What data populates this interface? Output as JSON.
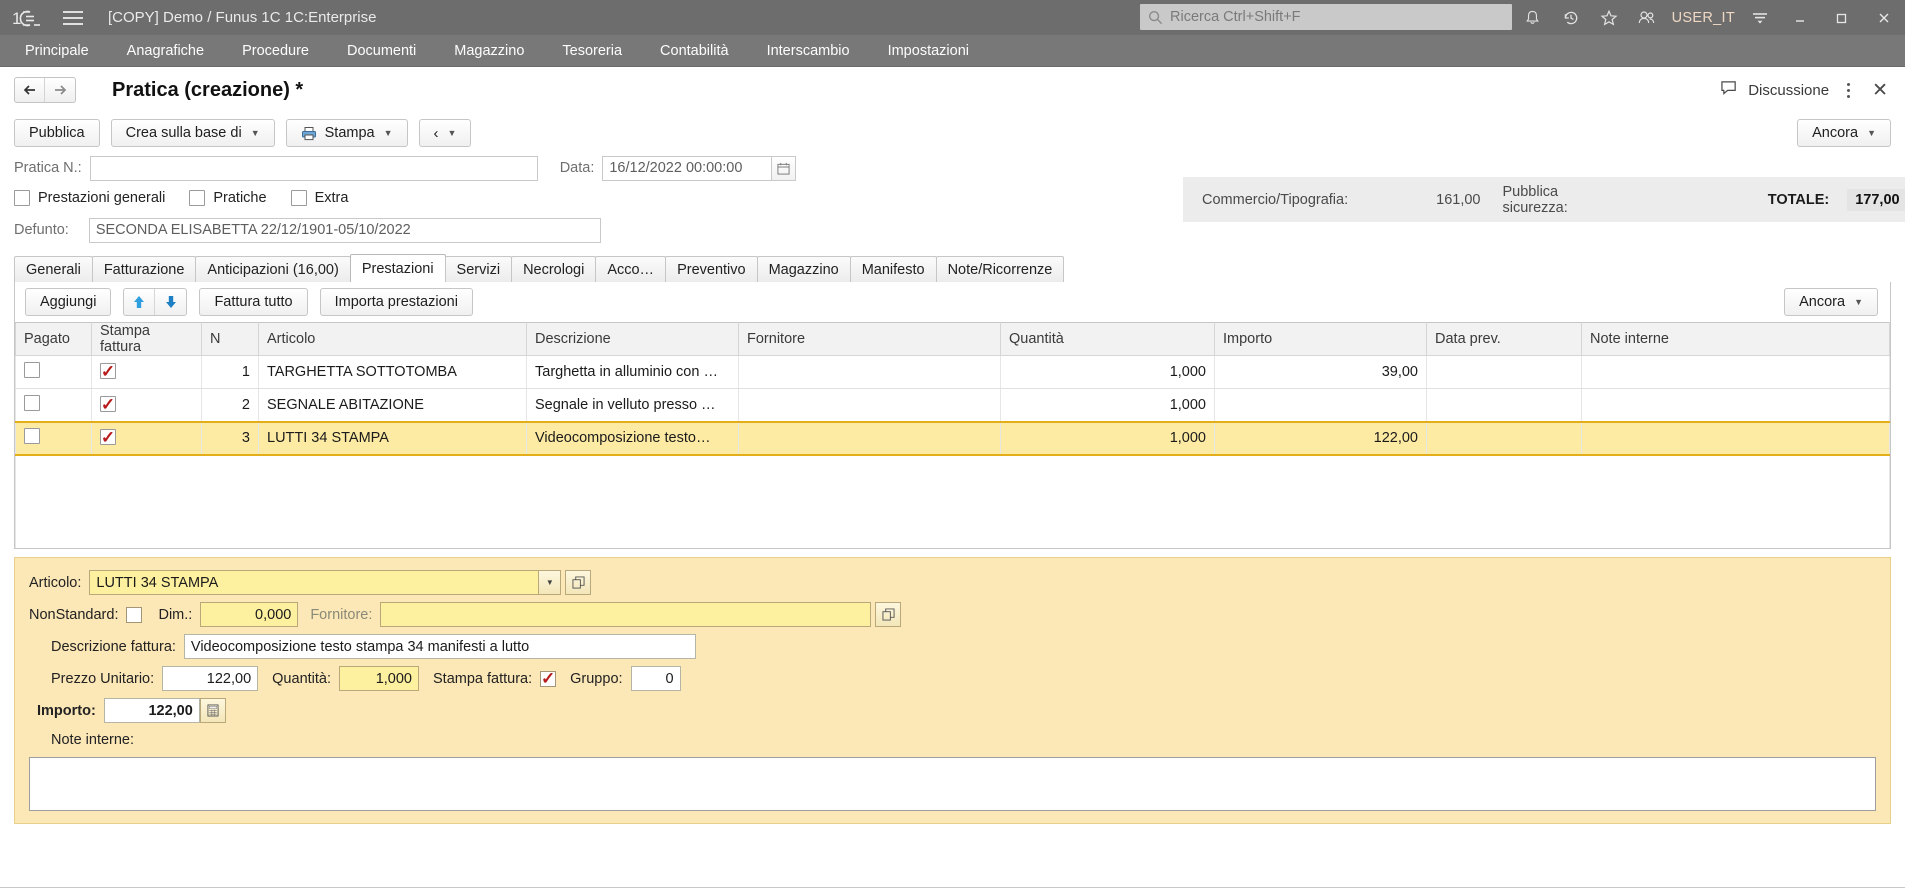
{
  "system_bar": {
    "logo": "1c-logo-icon",
    "title": "[COPY] Demo / Funus 1C 1C:Enterprise",
    "search_placeholder": "Ricerca Ctrl+Shift+F",
    "user": "USER_IT",
    "icons": [
      "bell-icon",
      "history-icon",
      "star-icon",
      "users-icon",
      "menu-lines-icon"
    ],
    "window_controls": [
      "minimize",
      "restore",
      "close"
    ]
  },
  "main_menu": {
    "items": [
      {
        "label": "Principale"
      },
      {
        "label": "Anagrafiche"
      },
      {
        "label": "Procedure"
      },
      {
        "label": "Documenti"
      },
      {
        "label": "Magazzino"
      },
      {
        "label": "Tesoreria"
      },
      {
        "label": "Contabilità"
      },
      {
        "label": "Interscambio"
      },
      {
        "label": "Impostazioni"
      }
    ]
  },
  "form_header": {
    "title": "Pratica (creazione) *",
    "discussion_label": "Discussione",
    "back_icon": "arrow-left-icon",
    "forward_icon": "arrow-right-icon"
  },
  "command_bar": {
    "publish": "Pubblica",
    "create_based_on": "Crea sulla base di",
    "print": "Stampa",
    "more": "Ancora"
  },
  "form_fields": {
    "pratica_label": "Pratica N.:",
    "pratica_value": "",
    "data_label": "Data:",
    "data_value": "16/12/2022 00:00:00",
    "defunto_label": "Defunto:",
    "defunto_value": "SECONDA ELISABETTA 22/12/1901-05/10/2022",
    "checkboxes": [
      {
        "label": "Prestazioni generali",
        "checked": false
      },
      {
        "label": "Pratiche",
        "checked": false
      },
      {
        "label": "Extra",
        "checked": false
      }
    ]
  },
  "totals": {
    "commercio_label": "Commercio/Tipografia:",
    "commercio_value": "161,00",
    "pubblica_label": "Pubblica sicurezza:",
    "pubblica_value": "",
    "totale_label": "TOTALE:",
    "totale_value": "177,00"
  },
  "tabs": [
    {
      "label": "Generali",
      "active": false
    },
    {
      "label": "Fatturazione",
      "active": false
    },
    {
      "label": "Anticipazioni (16,00)",
      "active": false
    },
    {
      "label": "Prestazioni",
      "active": true
    },
    {
      "label": "Servizi",
      "active": false
    },
    {
      "label": "Necrologi",
      "active": false
    },
    {
      "label": "Acco…",
      "active": false
    },
    {
      "label": "Preventivo",
      "active": false
    },
    {
      "label": "Magazzino",
      "active": false
    },
    {
      "label": "Manifesto",
      "active": false
    },
    {
      "label": "Note/Ricorrenze",
      "active": false
    }
  ],
  "panel_toolbar": {
    "add": "Aggiungi",
    "move_up_icon": "arrow-up-icon",
    "move_down_icon": "arrow-down-icon",
    "invoice_all": "Fattura tutto",
    "import": "Importa prestazioni",
    "more": "Ancora"
  },
  "table": {
    "columns": [
      "Pagato",
      "Stampa fattura",
      "N",
      "Articolo",
      "Descrizione",
      "Fornitore",
      "Quantità",
      "Importo",
      "Data prev.",
      "Note interne"
    ],
    "rows": [
      {
        "pagato": false,
        "stampa_fattura": true,
        "n": "1",
        "articolo": "TARGHETTA SOTTOTOMBA",
        "descrizione": "Targhetta in alluminio con …",
        "fornitore": "",
        "quantita": "1,000",
        "importo": "39,00",
        "data_prev": "",
        "note_interne": "",
        "selected": false
      },
      {
        "pagato": false,
        "stampa_fattura": true,
        "n": "2",
        "articolo": "SEGNALE ABITAZIONE",
        "descrizione": "Segnale in velluto presso …",
        "fornitore": "",
        "quantita": "1,000",
        "importo": "",
        "data_prev": "",
        "note_interne": "",
        "selected": false
      },
      {
        "pagato": false,
        "stampa_fattura": true,
        "n": "3",
        "articolo": "LUTTI 34 STAMPA",
        "descrizione": "Videocomposizione testo…",
        "fornitore": "",
        "quantita": "1,000",
        "importo": "122,00",
        "data_prev": "",
        "note_interne": "",
        "selected": true
      }
    ]
  },
  "detail": {
    "articolo_label": "Articolo:",
    "articolo_value": "LUTTI 34 STAMPA",
    "nonstandard_label": "NonStandard:",
    "nonstandard_checked": false,
    "dim_label": "Dim.:",
    "dim_value": "0,000",
    "fornitore_label": "Fornitore:",
    "fornitore_value": "",
    "descrizione_label": "Descrizione fattura:",
    "descrizione_value": "Videocomposizione testo stampa 34 manifesti a lutto",
    "prezzo_label": "Prezzo Unitario:",
    "prezzo_value": "122,00",
    "quantita_label": "Quantità:",
    "quantita_value": "1,000",
    "stampa_fattura_label": "Stampa fattura:",
    "stampa_fattura_checked": true,
    "gruppo_label": "Gruppo:",
    "gruppo_value": "0",
    "importo_label": "Importo:",
    "importo_value": "122,00",
    "note_label": "Note interne:",
    "note_value": ""
  },
  "colors": {
    "sysbar": "#6d6d6d",
    "menubar": "#787878",
    "selected_row": "#fdeba4",
    "detail_bg": "#fce7b7",
    "accent_check": "#b81b1b"
  }
}
